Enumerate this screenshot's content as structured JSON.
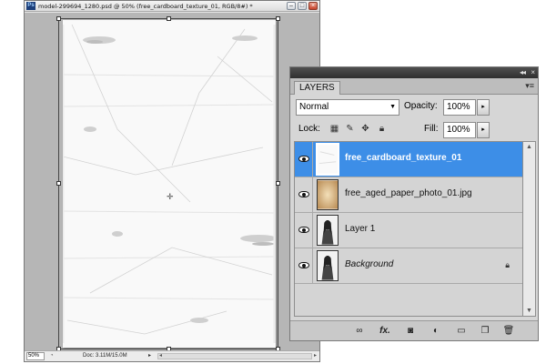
{
  "document": {
    "ps_icon_text": "Ps",
    "title": "model-299694_1280.psd @ 50% (free_cardboard_texture_01, RGB/8#) *",
    "zoom": "50%",
    "doc_size": "Doc: 3.11M/15.0M"
  },
  "layers_panel": {
    "tab_label": "LAYERS",
    "blend_mode": "Normal",
    "opacity_label": "Opacity:",
    "opacity_value": "100%",
    "lock_label": "Lock:",
    "fill_label": "Fill:",
    "fill_value": "100%",
    "layers": [
      {
        "name": "free_cardboard_texture_01",
        "selected": true,
        "visible": true
      },
      {
        "name": "free_aged_paper_photo_01.jpg",
        "selected": false,
        "visible": true
      },
      {
        "name": "Layer 1",
        "selected": false,
        "visible": true
      },
      {
        "name": "Background",
        "selected": false,
        "visible": true,
        "locked": true
      }
    ],
    "icons": {
      "window": [
        "minimize-icon",
        "maximize-icon",
        "close-icon"
      ],
      "lock": [
        "lock-transparent-pixels-icon",
        "lock-image-pixels-icon",
        "lock-position-icon",
        "lock-all-icon"
      ],
      "bottom": [
        "link-layers-icon",
        "layer-style-fx-icon",
        "add-mask-icon",
        "adjustment-layer-icon",
        "new-group-icon",
        "new-layer-icon",
        "delete-layer-icon"
      ]
    },
    "fx_label": "fx.",
    "colors": {
      "selection": "#3d8ee7",
      "panel_bg": "#d6d6d6",
      "canvas_bg": "#b6b6b6"
    }
  }
}
